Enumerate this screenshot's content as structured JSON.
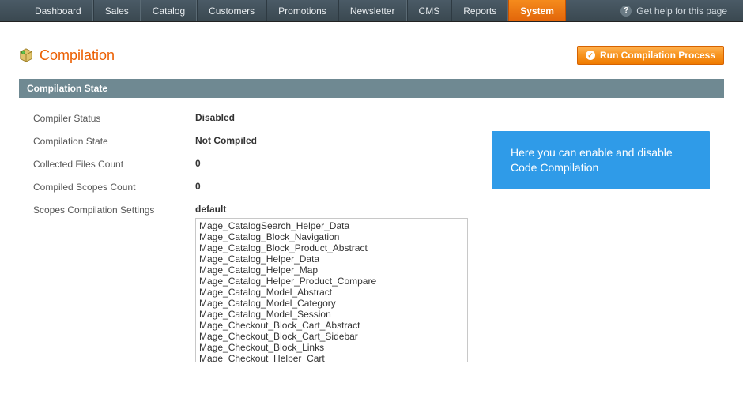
{
  "nav": {
    "items": [
      {
        "label": "Dashboard",
        "active": false
      },
      {
        "label": "Sales",
        "active": false
      },
      {
        "label": "Catalog",
        "active": false
      },
      {
        "label": "Customers",
        "active": false
      },
      {
        "label": "Promotions",
        "active": false
      },
      {
        "label": "Newsletter",
        "active": false
      },
      {
        "label": "CMS",
        "active": false
      },
      {
        "label": "Reports",
        "active": false
      },
      {
        "label": "System",
        "active": true
      }
    ],
    "help_label": "Get help for this page"
  },
  "page": {
    "title": "Compilation",
    "run_button": "Run Compilation Process"
  },
  "section": {
    "header": "Compilation State",
    "rows": {
      "compiler_status": {
        "label": "Compiler Status",
        "value": "Disabled"
      },
      "compilation_state": {
        "label": "Compilation State",
        "value": "Not Compiled"
      },
      "collected_files": {
        "label": "Collected Files Count",
        "value": "0"
      },
      "compiled_scopes": {
        "label": "Compiled Scopes Count",
        "value": "0"
      },
      "scopes_settings": {
        "label": "Scopes Compilation Settings",
        "value": "default"
      }
    },
    "scopes_list": [
      "Mage_CatalogSearch_Helper_Data",
      "Mage_Catalog_Block_Navigation",
      "Mage_Catalog_Block_Product_Abstract",
      "Mage_Catalog_Helper_Data",
      "Mage_Catalog_Helper_Map",
      "Mage_Catalog_Helper_Product_Compare",
      "Mage_Catalog_Model_Abstract",
      "Mage_Catalog_Model_Category",
      "Mage_Catalog_Model_Session",
      "Mage_Checkout_Block_Cart_Abstract",
      "Mage_Checkout_Block_Cart_Sidebar",
      "Mage_Checkout_Block_Links",
      "Mage_Checkout_Helper_Cart"
    ]
  },
  "info": {
    "text": "Here you can enable and disable Code Compilation"
  }
}
